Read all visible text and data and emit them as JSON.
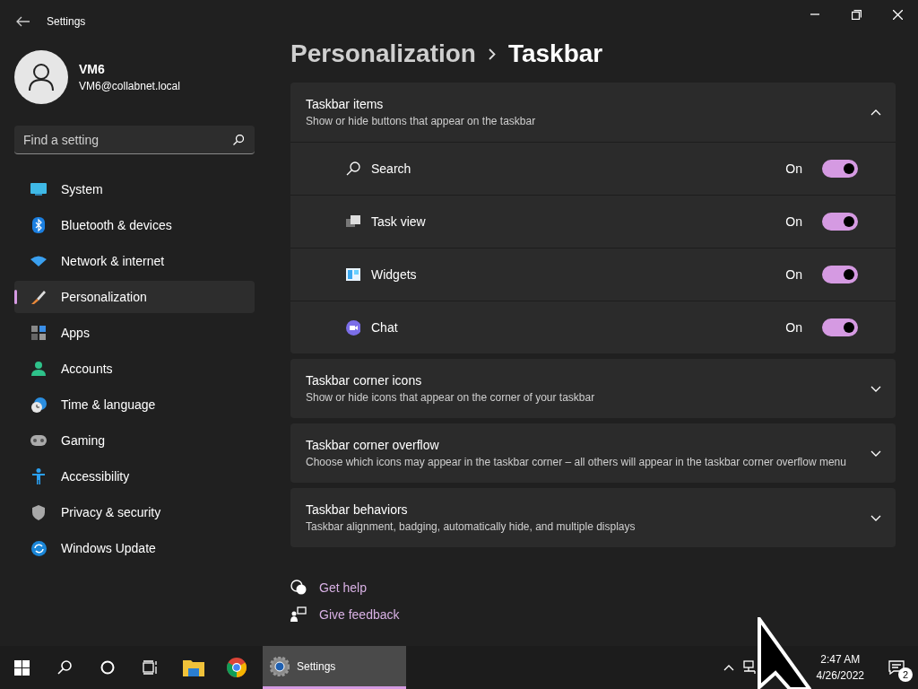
{
  "window": {
    "title": "Settings"
  },
  "profile": {
    "name": "VM6",
    "email": "VM6@collabnet.local"
  },
  "search": {
    "placeholder": "Find a setting"
  },
  "nav": [
    {
      "label": "System",
      "selected": false
    },
    {
      "label": "Bluetooth & devices",
      "selected": false
    },
    {
      "label": "Network & internet",
      "selected": false
    },
    {
      "label": "Personalization",
      "selected": true
    },
    {
      "label": "Apps",
      "selected": false
    },
    {
      "label": "Accounts",
      "selected": false
    },
    {
      "label": "Time & language",
      "selected": false
    },
    {
      "label": "Gaming",
      "selected": false
    },
    {
      "label": "Accessibility",
      "selected": false
    },
    {
      "label": "Privacy & security",
      "selected": false
    },
    {
      "label": "Windows Update",
      "selected": false
    }
  ],
  "breadcrumb": {
    "parent": "Personalization",
    "current": "Taskbar"
  },
  "sections": [
    {
      "title": "Taskbar items",
      "subtitle": "Show or hide buttons that appear on the taskbar",
      "expanded": true,
      "rows": [
        {
          "label": "Search",
          "state": "On",
          "on": true
        },
        {
          "label": "Task view",
          "state": "On",
          "on": true
        },
        {
          "label": "Widgets",
          "state": "On",
          "on": true
        },
        {
          "label": "Chat",
          "state": "On",
          "on": true
        }
      ]
    },
    {
      "title": "Taskbar corner icons",
      "subtitle": "Show or hide icons that appear on the corner of your taskbar",
      "expanded": false
    },
    {
      "title": "Taskbar corner overflow",
      "subtitle": "Choose which icons may appear in the taskbar corner – all others will appear in the taskbar corner overflow menu",
      "expanded": false
    },
    {
      "title": "Taskbar behaviors",
      "subtitle": "Taskbar alignment, badging, automatically hide, and multiple displays",
      "expanded": false
    }
  ],
  "links": [
    {
      "label": "Get help"
    },
    {
      "label": "Give feedback"
    }
  ],
  "taskbar": {
    "app": {
      "label": "Settings",
      "selected": true
    },
    "time": "2:47 AM",
    "date": "4/26/2022",
    "notifications": "2"
  }
}
